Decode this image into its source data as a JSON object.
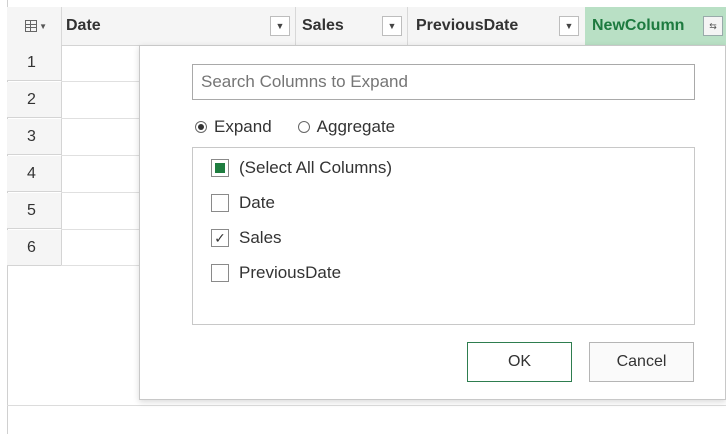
{
  "header": {
    "table_menu_icon": "table-grid-icon",
    "columns": [
      {
        "label": "Date"
      },
      {
        "label": "Sales"
      },
      {
        "label": "PreviousDate"
      },
      {
        "label": "NewColumn"
      }
    ]
  },
  "rows": [
    "1",
    "2",
    "3",
    "4",
    "5",
    "6"
  ],
  "dialog": {
    "search_placeholder": "Search Columns to Expand",
    "radios": [
      {
        "label": "Expand",
        "selected": true
      },
      {
        "label": "Aggregate",
        "selected": false
      }
    ],
    "items": [
      {
        "label": "(Select All Columns)",
        "state": "partial"
      },
      {
        "label": "Date",
        "state": "unchecked"
      },
      {
        "label": "Sales",
        "state": "checked"
      },
      {
        "label": "PreviousDate",
        "state": "unchecked"
      }
    ],
    "ok_label": "OK",
    "cancel_label": "Cancel"
  },
  "colors": {
    "new_column_bg": "#b9e0c5",
    "new_column_text": "#1d7a3f",
    "partial_fill": "#1e7d3f"
  }
}
